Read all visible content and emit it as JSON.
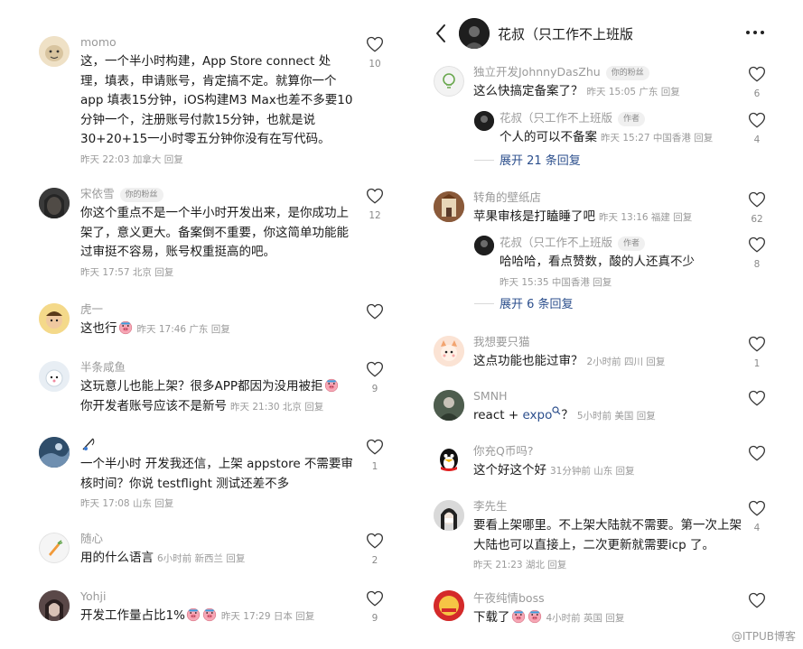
{
  "left": {
    "comments": [
      {
        "name": "momo",
        "badge": "",
        "text": "这，一个半小时构建，App Store connect 处理，填表，申请账号，肯定搞不定。就算你一个 app 填表15分钟，iOS构建M3 Max也差不多要10分钟一个，注册账号付款15分钟，也就是说30+20+15一小时零五分钟你没有在写代码。",
        "meta": "昨天 22:03 加拿大 回复",
        "likes": "10"
      },
      {
        "name": "宋依雪",
        "badge": "你的粉丝",
        "text": "你这个重点不是一个半小时开发出来，是你成功上架了，意义更大。备案倒不重要，你这简单功能能过审挺不容易，账号权重挺高的吧。",
        "meta": "昨天 17:57 北京 回复",
        "likes": "12"
      },
      {
        "name": "虎一",
        "badge": "",
        "text": "这也行",
        "meta": "昨天 17:46 广东 回复",
        "likes": ""
      },
      {
        "name": "半条咸鱼",
        "badge": "",
        "text": "这玩意儿也能上架？很多APP都因为没用被拒",
        "text2": "你开发者账号应该不是新号",
        "meta": "昨天 21:30 北京 回复",
        "likes": "9"
      },
      {
        "name": "",
        "badge": "",
        "text": "一个半小时 开发我还信，上架 appstore 不需要审核时间？你说 testflight 测试还差不多",
        "meta": "昨天 17:08 山东 回复",
        "likes": "1"
      },
      {
        "name": "随心",
        "badge": "",
        "text": "用的什么语言",
        "meta": "6小时前 新西兰 回复",
        "likes": "2"
      },
      {
        "name": "Yohji",
        "badge": "",
        "text": "开发工作量占比1%",
        "meta": "昨天 17:29 日本 回复",
        "likes": "9"
      }
    ]
  },
  "right": {
    "header": {
      "title": "花叔（只工作不上班版"
    },
    "comments": [
      {
        "name": "独立开发JohnnyDasZhu",
        "badge": "你的粉丝",
        "text": "这么快搞定备案了？",
        "meta": "昨天 15:05 广东 回复",
        "likes": "6"
      },
      {
        "name": "花叔（只工作不上班版",
        "badge": "作者",
        "text": "个人的可以不备案",
        "meta": "昨天 15:27 中国香港 回复",
        "likes": "4"
      },
      {
        "expand": "展开 21 条回复"
      },
      {
        "name": "转角的壁纸店",
        "badge": "",
        "text": "苹果审核是打瞌睡了吧",
        "meta": "昨天 13:16 福建 回复",
        "likes": "62"
      },
      {
        "name": "花叔（只工作不上班版",
        "badge": "作者",
        "text": "哈哈哈，看点赞数，酸的人还真不少",
        "meta": "昨天 15:35 中国香港 回复",
        "likes": "8"
      },
      {
        "expand": "展开 6 条回复"
      },
      {
        "name": "我想要只猫",
        "badge": "",
        "text": "这点功能也能过审？",
        "meta": "2小时前 四川 回复",
        "likes": "1"
      },
      {
        "name": "SMNH",
        "badge": "",
        "text": "react + ",
        "link": "expo",
        "text_after": "？",
        "meta": "5小时前 美国 回复",
        "likes": ""
      },
      {
        "name": "你充Q币吗?",
        "badge": "",
        "text": "这个好这个好",
        "meta": "31分钟前 山东 回复",
        "likes": ""
      },
      {
        "name": "李先生",
        "badge": "",
        "text": "要看上架哪里。不上架大陆就不需要。第一次上架大陆也可以直接上，二次更新就需要icp 了。",
        "meta": "昨天 21:23 湖北 回复",
        "likes": "4"
      },
      {
        "name": "午夜纯情boss",
        "badge": "",
        "text": "下载了",
        "meta": "4小时前 英国 回复",
        "likes": ""
      }
    ]
  },
  "watermark": "@ITPUB博客",
  "colors": {
    "accent_link": "#2b4e8c",
    "meta": "#9a9a9a",
    "text": "#1a1a1a"
  }
}
